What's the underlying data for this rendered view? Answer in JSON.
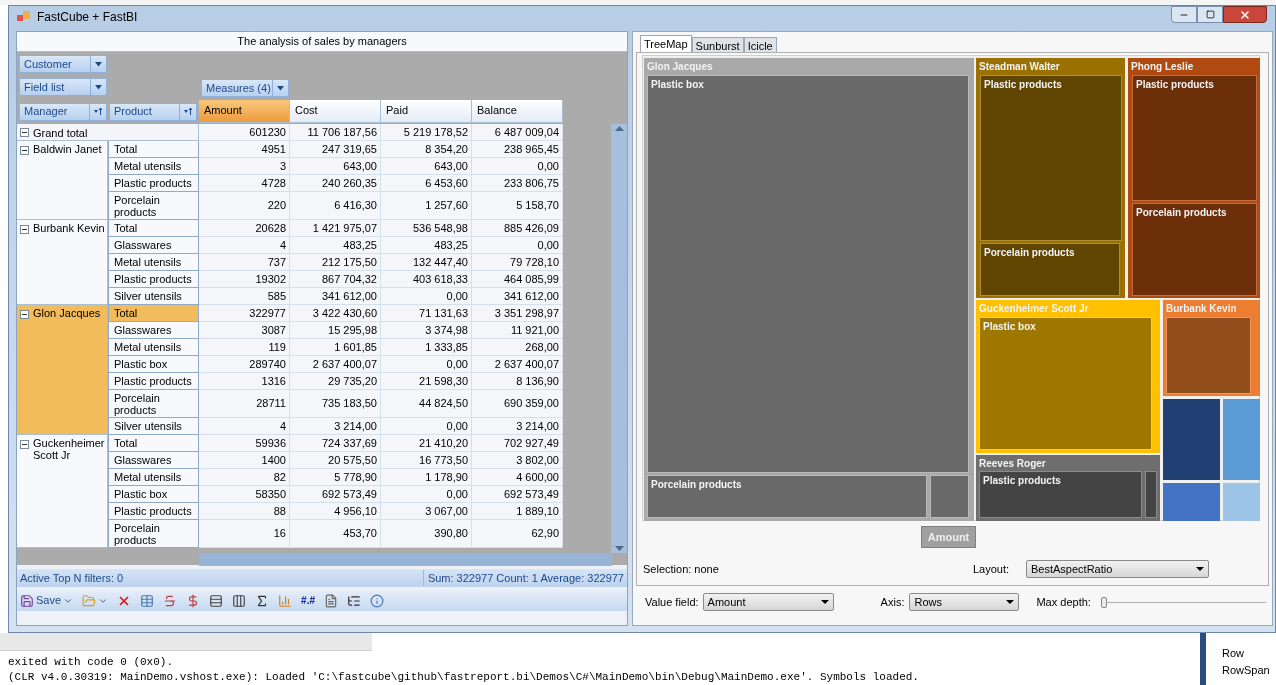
{
  "window": {
    "title": "FastCube + FastBI"
  },
  "pivot": {
    "title": "The analysis of sales by managers",
    "filter_fields": [
      "Customer"
    ],
    "field_list": "Field list",
    "measures": "Measures (4)",
    "row_fields": [
      "Manager",
      "Product"
    ],
    "columns": [
      {
        "label": "Amount",
        "selected": true
      },
      {
        "label": "Cost",
        "selected": false
      },
      {
        "label": "Paid",
        "selected": false
      },
      {
        "label": "Balance",
        "selected": false
      }
    ],
    "grand_total": {
      "label": "Grand total",
      "expanded": true,
      "values": [
        "601230",
        "11 706 187,56",
        "5 219 178,52",
        "6 487 009,04"
      ]
    },
    "groups": [
      {
        "manager": "Baldwin  Janet",
        "expanded": true,
        "selected": false,
        "rows": [
          {
            "product": "Total",
            "selected": false,
            "values": [
              "4951",
              "247 319,65",
              "8 354,20",
              "238 965,45"
            ]
          },
          {
            "product": "Metal utensils",
            "selected": false,
            "values": [
              "3",
              "643,00",
              "643,00",
              "0,00"
            ]
          },
          {
            "product": "Plastic products",
            "selected": false,
            "values": [
              "4728",
              "240 260,35",
              "6 453,60",
              "233 806,75"
            ]
          },
          {
            "product": "Porcelain products",
            "selected": false,
            "values": [
              "220",
              "6 416,30",
              "1 257,60",
              "5 158,70"
            ]
          }
        ]
      },
      {
        "manager": "Burbank Kevin",
        "expanded": true,
        "selected": false,
        "rows": [
          {
            "product": "Total",
            "selected": false,
            "values": [
              "20628",
              "1 421 975,07",
              "536 548,98",
              "885 426,09"
            ]
          },
          {
            "product": "Glasswares",
            "selected": false,
            "values": [
              "4",
              "483,25",
              "483,25",
              "0,00"
            ]
          },
          {
            "product": "Metal utensils",
            "selected": false,
            "values": [
              "737",
              "212 175,50",
              "132 447,40",
              "79 728,10"
            ]
          },
          {
            "product": "Plastic products",
            "selected": false,
            "values": [
              "19302",
              "867 704,32",
              "403 618,33",
              "464 085,99"
            ]
          },
          {
            "product": "Silver utensils",
            "selected": false,
            "values": [
              "585",
              "341 612,00",
              "0,00",
              "341 612,00"
            ]
          }
        ]
      },
      {
        "manager": "Glon Jacques",
        "expanded": true,
        "selected": true,
        "rows": [
          {
            "product": "Total",
            "selected": true,
            "values": [
              "322977",
              "3 422 430,60",
              "71 131,63",
              "3 351 298,97"
            ]
          },
          {
            "product": "Glasswares",
            "selected": false,
            "values": [
              "3087",
              "15 295,98",
              "3 374,98",
              "11 921,00"
            ]
          },
          {
            "product": "Metal utensils",
            "selected": false,
            "values": [
              "119",
              "1 601,85",
              "1 333,85",
              "268,00"
            ]
          },
          {
            "product": "Plastic box",
            "selected": false,
            "values": [
              "289740",
              "2 637 400,07",
              "0,00",
              "2 637 400,07"
            ]
          },
          {
            "product": "Plastic products",
            "selected": false,
            "values": [
              "1316",
              "29 735,20",
              "21 598,30",
              "8 136,90"
            ]
          },
          {
            "product": "Porcelain products",
            "selected": false,
            "values": [
              "28711",
              "735 183,50",
              "44 824,50",
              "690 359,00"
            ]
          },
          {
            "product": "Silver utensils",
            "selected": false,
            "values": [
              "4",
              "3 214,00",
              "0,00",
              "3 214,00"
            ]
          }
        ]
      },
      {
        "manager": "Guckenheimer Scott  Jr",
        "expanded": true,
        "selected": false,
        "rows": [
          {
            "product": "Total",
            "selected": false,
            "values": [
              "59936",
              "724 337,69",
              "21 410,20",
              "702 927,49"
            ]
          },
          {
            "product": "Glasswares",
            "selected": false,
            "values": [
              "1400",
              "20 575,50",
              "16 773,50",
              "3 802,00"
            ]
          },
          {
            "product": "Metal utensils",
            "selected": false,
            "values": [
              "82",
              "5 778,90",
              "1 178,90",
              "4 600,00"
            ]
          },
          {
            "product": "Plastic box",
            "selected": false,
            "values": [
              "58350",
              "692 573,49",
              "0,00",
              "692 573,49"
            ]
          },
          {
            "product": "Plastic products",
            "selected": false,
            "values": [
              "88",
              "4 956,10",
              "3 067,00",
              "1 889,10"
            ]
          },
          {
            "product": "Porcelain products",
            "selected": false,
            "values": [
              "16",
              "453,70",
              "390,80",
              "62,90"
            ]
          }
        ]
      }
    ],
    "status_left": "Active Top N filters: 0",
    "status_right": "Sum: 322977 Count: 1 Average: 322977",
    "toolbar": {
      "save": "Save",
      "number_format": "#.#"
    }
  },
  "chart_panel": {
    "tabs": [
      {
        "label": "TreeMap",
        "selected": true
      },
      {
        "label": "Sunburst",
        "selected": false
      },
      {
        "label": "Icicle",
        "selected": false
      }
    ],
    "treemap": {
      "nodes": [
        {
          "label": "Glon Jacques",
          "color": "#a9a9a9",
          "children": [
            {
              "kind": "labeled",
              "label": "Plastic box"
            },
            {
              "kind": "labeled",
              "label": "Porcelain products"
            },
            {
              "kind": "plain"
            }
          ]
        },
        {
          "label": "Steadman Walter",
          "color": "#9a7000",
          "children": [
            {
              "kind": "labeled",
              "label": "Plastic products"
            },
            {
              "kind": "labeled",
              "label": "Porcelain products"
            }
          ]
        },
        {
          "label": "Phong  Leslie",
          "color": "#b04a10",
          "children": [
            {
              "kind": "labeled",
              "label": "Plastic products"
            },
            {
              "kind": "labeled",
              "label": "Porcelain products"
            }
          ]
        },
        {
          "label": "Guckenheimer Scott  Jr",
          "color": "#ffc000",
          "children": [
            {
              "kind": "labeled",
              "label": "Plastic box"
            }
          ]
        },
        {
          "label": "Burbank Kevin",
          "color": "#ed7d31",
          "children": [
            {
              "kind": "plain"
            }
          ]
        },
        {
          "label": "Reeves  Roger",
          "color": "#6e6e6e",
          "children": [
            {
              "kind": "labeled",
              "label": "Plastic products"
            },
            {
              "kind": "plain"
            }
          ]
        },
        {
          "color": "#213f72"
        },
        {
          "color": "#5b9bd5"
        },
        {
          "color": "#4472c4"
        },
        {
          "color": "#9dc3e6"
        }
      ]
    },
    "value_button": "Amount",
    "selection": "Selection: none",
    "layout_label": "Layout:",
    "layout_value": "BestAspectRatio",
    "value_field_label": "Value field:",
    "value_field": "Amount",
    "axis_label": "Axis:",
    "axis_value": "Rows",
    "max_depth_label": "Max depth:",
    "max_depth": {
      "level": 0
    }
  },
  "output": [
    "exited with code 0 (0x0).",
    "(CLR v4.0.30319: MainDemo.vshost.exe): Loaded 'C:\\fastcube\\github\\fastreport.bi\\Demos\\C#\\MainDemo\\bin\\Debug\\MainDemo.exe'. Symbols loaded."
  ],
  "side_list": [
    "Row",
    "RowSpan"
  ]
}
